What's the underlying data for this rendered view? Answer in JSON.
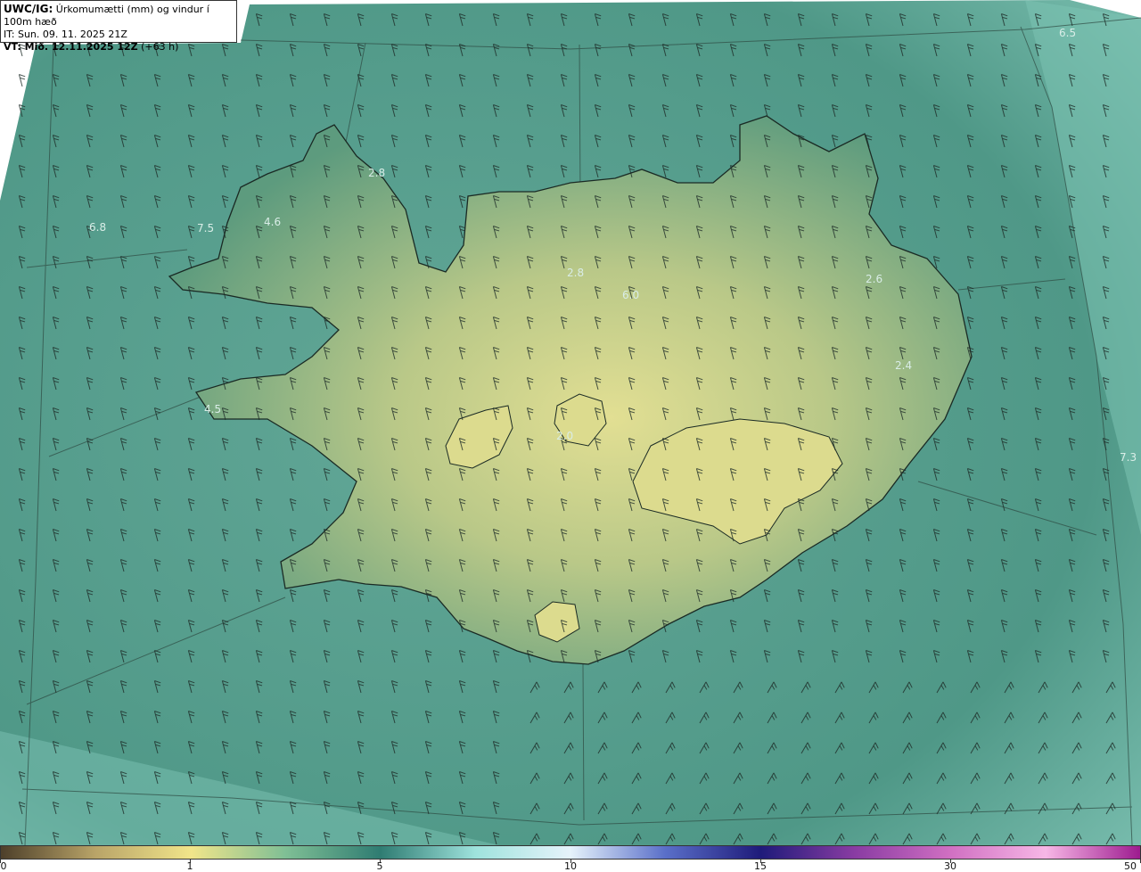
{
  "header": {
    "model": "UWC/IG:",
    "title": "Úrkomumætti (mm) og vindur í 100m hæð",
    "init_time": "IT: Sun. 09. 11. 2025 21Z",
    "valid_prefix": "VT: Mið. 12.11.2025 12Z",
    "valid_suffix": "(+63 h)"
  },
  "map": {
    "region": "Iceland",
    "field": "precipitable water",
    "overlay": "wind barbs at 100 m",
    "colors": {
      "ocean": "#5fa79a",
      "ocean_light": "#84c5b6",
      "land_low": "#4a8c73",
      "land_mid": "#8fb37c",
      "land_high": "#d7d88b",
      "coastline": "#1a2a24"
    },
    "point_labels": [
      "6.5",
      "6.8",
      "7.5",
      "4.6",
      "2.8",
      "2.8",
      "6.0",
      "2.6",
      "2.4",
      "4.5",
      "2.0",
      "7.3"
    ]
  },
  "colorbar": {
    "tick_labels": [
      "0",
      "1",
      "5",
      "10",
      "15",
      "30",
      "50"
    ],
    "colors": [
      "#4d3f2a",
      "#b9a468",
      "#f1e58a",
      "#7fbf95",
      "#2f7c72",
      "#9fe3dd",
      "#e6f3fb",
      "#5a6fc9",
      "#1f1b7a",
      "#8a3ca3",
      "#d06fc2",
      "#f7b7e6",
      "#9d1b8f"
    ]
  }
}
